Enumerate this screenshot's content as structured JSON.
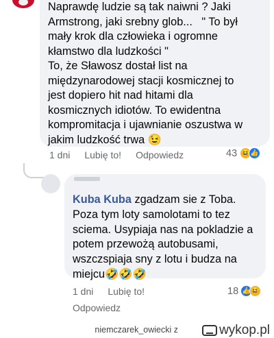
{
  "comment1": {
    "lines": [
      "Naprawdę ludzie są tak naiwni ? Jaki",
      "Armstrong, jaki srebny glob...   \" To był",
      "mały krok dla człowieka i ogromne",
      "kłamstwo dla ludzkości \"",
      "To, że Sławosz dostał list na",
      "międzynarodowej stacji kosmicznej to",
      "jest dopiero hit nad hitami dla",
      "kosmicznych idiotów. To ewidentna",
      "kompromitacja i ujawnianie oszustwa w",
      "jakim ludzkość trwa 😉"
    ],
    "time": "1 dni",
    "like_label": "Lubię to!",
    "reply_label": "Odpowiedz",
    "reaction_count": "43"
  },
  "comment2": {
    "mention": "Kuba Kuba",
    "line1_rest": " zgadzam sie z Toba.",
    "lines": [
      "Poza tym loty samolotami to tez",
      "sciema. Usypiaja nas na pokladzie a",
      "potem przewożą autobusami,",
      "wszczspiaja sny z lotu i budza na",
      "miejcu🤣🤣🤣"
    ],
    "time": "1 dni",
    "like_label": "Lubię to!",
    "reply_label": "Odpowiedz",
    "reaction_count": "18"
  },
  "icons": {
    "haha": "😆",
    "like": "👍"
  },
  "footer": {
    "username": "niemczarek_owiecki z",
    "brand": "wykop.pl"
  }
}
